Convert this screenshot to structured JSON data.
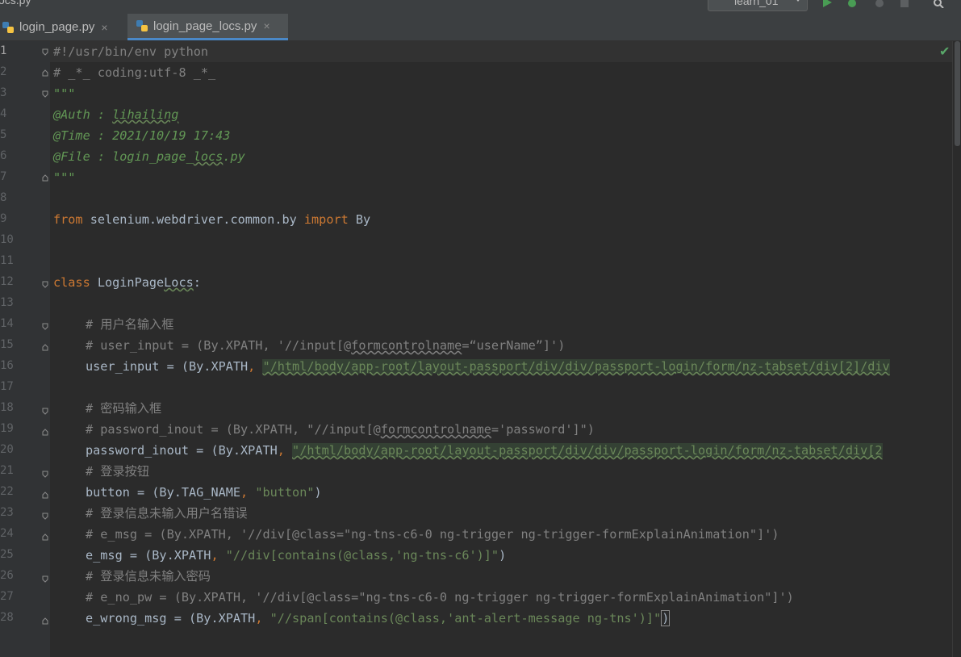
{
  "window": {
    "title": "ocs.py",
    "run_config": "learn_01"
  },
  "tabs": [
    {
      "label": "login_page.py",
      "active": false
    },
    {
      "label": "login_page_locs.py",
      "active": true
    }
  ],
  "editor": {
    "line_numbers": [
      "1",
      "2",
      "3",
      "4",
      "5",
      "6",
      "7",
      "8",
      "9",
      "10",
      "11",
      "12",
      "13",
      "14",
      "15",
      "16",
      "17",
      "18",
      "19",
      "20",
      "21",
      "22",
      "23",
      "24",
      "25",
      "26",
      "27",
      "28"
    ],
    "lines": {
      "l1": "#!/usr/bin/env python",
      "l2": "# _*_ coding:utf-8 _*_",
      "l3": "\"\"\"",
      "l4a": "@Auth : ",
      "l4b": "lihailing",
      "l5": "@Time : 2021/10/19 17:43",
      "l6a": "@File : login_page_",
      "l6b": "locs",
      "l6c": ".py",
      "l7": "\"\"\"",
      "l9a": "from",
      "l9b": " selenium.webdriver.common.by ",
      "l9c": "import",
      "l9d": " By",
      "l12a": "class",
      "l12b": " LoginPage",
      "l12c": "Locs",
      "l12d": ":",
      "l14": "# 用户名输入框",
      "l15a": "# user_input = (By.XPATH, '//input[@",
      "l15b": "formcontrolname",
      "l15c": "=“userName”]')",
      "l16a": "user_input = (By.XPATH",
      "l16b": ", ",
      "l16c": "\"/html/body/app-root/layout-passport/div/div/passport-login/form/nz-tabset/div[2]/div",
      "l18": "# 密码输入框",
      "l19a": "# password_inout = (By.XPATH, \"//input[@",
      "l19b": "formcontrolname",
      "l19c": "='password']\")",
      "l20a": "password_inout = (By.XPATH",
      "l20b": ", ",
      "l20c": "\"/html/body/app-root/layout-passport/div/div/passport-login/form/nz-tabset/div[2",
      "l21": "# 登录按钮",
      "l22a": "button = (By.TAG_NAME",
      "l22b": ", ",
      "l22c": "\"button\"",
      "l22d": ")",
      "l23": "# 登录信息未输入用户名错误",
      "l24": "# e_msg = (By.XPATH, '//div[@class=\"ng-tns-c6-0 ng-trigger ng-trigger-formExplainAnimation\"]')",
      "l25a": "e_msg = (By.XPATH",
      "l25b": ", ",
      "l25c": "\"//div[contains(@class,'ng-tns-c6')]\"",
      "l25d": ")",
      "l26": "# 登录信息未输入密码",
      "l27": "# e_no_pw = (By.XPATH, '//div[@class=\"ng-tns-c6-0 ng-trigger ng-trigger-formExplainAnimation\"]')",
      "l28a": "e_wrong_msg = (By.XPATH",
      "l28b": ", ",
      "l28c": "\"//span[contains(@class,'ant-alert-message ng-tns')]\"",
      "l28d": ")"
    }
  },
  "colors": {
    "keyword": "#cc7832",
    "comment": "#808080",
    "docstring": "#629755",
    "string": "#6a8759",
    "text": "#a9b7c6",
    "background": "#2b2b2b"
  }
}
